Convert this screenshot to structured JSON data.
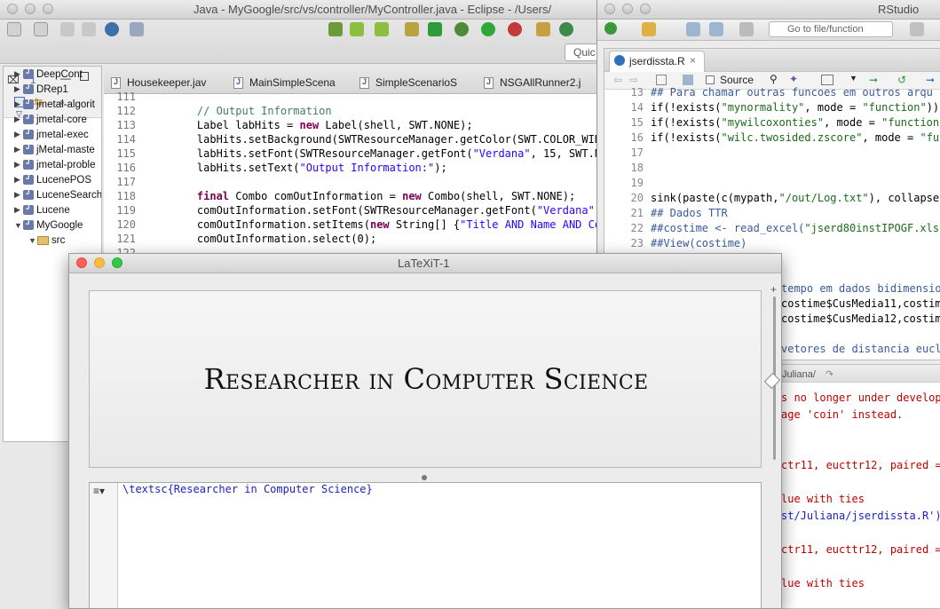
{
  "eclipse": {
    "title": "Java - MyGoogle/src/vs/controller/MyController.java - Eclipse - /Users/",
    "quick_access": "Quic",
    "pkg_toolbar": {
      "view_label": "1",
      "close_glyph": "⌧"
    },
    "tree": [
      {
        "label": "DeepCont",
        "kind": "proj"
      },
      {
        "label": "DRep1",
        "kind": "proj"
      },
      {
        "label": "jmetal-algorit",
        "kind": "proj"
      },
      {
        "label": "jmetal-core",
        "kind": "proj"
      },
      {
        "label": "jmetal-exec",
        "kind": "proj"
      },
      {
        "label": "jMetal-maste",
        "kind": "proj"
      },
      {
        "label": "jmetal-proble",
        "kind": "proj"
      },
      {
        "label": "LucenePOS",
        "kind": "proj"
      },
      {
        "label": "LuceneSearch",
        "kind": "proj"
      },
      {
        "label": "Lucene",
        "kind": "proj"
      },
      {
        "label": "MyGoogle",
        "kind": "proj"
      },
      {
        "label": "src",
        "kind": "src"
      }
    ],
    "tabs": [
      "Housekeeper.jav",
      "MainSimpleScena",
      "SimpleScenarioS",
      "NSGAllRunner2.j"
    ],
    "lines": [
      {
        "n": "111",
        "code": ""
      },
      {
        "n": "112",
        "code": "    // Output Information"
      },
      {
        "n": "113",
        "code": "    Label labHits = new Label(shell, SWT.NONE);"
      },
      {
        "n": "114",
        "code": "    labHits.setBackground(SWTResourceManager.getColor(SWT.COLOR_WIDGET_LI"
      },
      {
        "n": "115",
        "code": "    labHits.setFont(SWTResourceManager.getFont(\"Verdana\", 15, SWT.NORMAL"
      },
      {
        "n": "116",
        "code": "    labHits.setText(\"Output Information:\");"
      },
      {
        "n": "117",
        "code": ""
      },
      {
        "n": "118",
        "code": "    final Combo comOutInformation = new Combo(shell, SWT.NONE);"
      },
      {
        "n": "119",
        "code": "    comOutInformation.setFont(SWTResourceManager.getFont(\"Verdana\", 12, S"
      },
      {
        "n": "120",
        "code": "    comOutInformation.setItems(new String[] {\"Title AND Name AND Content\""
      },
      {
        "n": "121",
        "code": "    comOutInformation.select(0);"
      },
      {
        "n": "122",
        "code": ""
      }
    ]
  },
  "rstudio": {
    "title": "RStudio",
    "goto_placeholder": "Go to file/function",
    "tab_label": "jserdissta.R",
    "source_label": "Source",
    "lines": [
      {
        "n": "13",
        "code": "## Para chamar outras funcoes em outros arqu"
      },
      {
        "n": "14",
        "code": "if(!exists(\"mynormality\", mode = \"function\"))"
      },
      {
        "n": "15",
        "code": "if(!exists(\"mywilcoxonties\", mode = \"function"
      },
      {
        "n": "16",
        "code": "if(!exists(\"wilc.twosided.zscore\", mode = \"fu"
      },
      {
        "n": "17",
        "code": ""
      },
      {
        "n": "18",
        "code": ""
      },
      {
        "n": "19",
        "code": ""
      },
      {
        "n": "20",
        "code": "sink(paste(c(mypath,\"/out/Log.txt\"), collapse"
      },
      {
        "n": "21",
        "code": "## Dados TTR"
      },
      {
        "n": "22",
        "code": "##costime <- read_excel(\"jserd80instIPOGF.xls"
      },
      {
        "n": "23",
        "code": "##View(costime)"
      }
    ],
    "hidden_src_lines": [
      "tempo em dados bidimensio",
      "costime$CusMedia11,costim",
      "costime$CusMedia12,costim",
      "",
      "vetores de distancia eucl"
    ],
    "console_path": "Juliana/",
    "console_lines": [
      {
        "text": "s no longer under develop",
        "color": "#c00000"
      },
      {
        "text": "age 'coin' instead.",
        "color": "#c00000"
      },
      {
        "text": "",
        "color": "#000"
      },
      {
        "text": "",
        "color": "#000"
      },
      {
        "text": "ctr11, eucttr12, paired =",
        "color": "#c00000"
      },
      {
        "text": "",
        "color": "#000"
      },
      {
        "text": "lue with ties",
        "color": "#c00000"
      },
      {
        "text": "st/Juliana/jserdissta.R')",
        "color": "#2020c0"
      },
      {
        "text": "",
        "color": "#000"
      },
      {
        "text": "ctr11, eucttr12, paired =",
        "color": "#c00000"
      },
      {
        "text": "",
        "color": "#000"
      },
      {
        "text": "lue with ties",
        "color": "#c00000"
      }
    ]
  },
  "latexit": {
    "title": "LaTeXiT-1",
    "rendered": "Researcher in Computer Science",
    "source": "\\textsc{Researcher in Computer Science}",
    "menu_glyph": "≡▾"
  }
}
